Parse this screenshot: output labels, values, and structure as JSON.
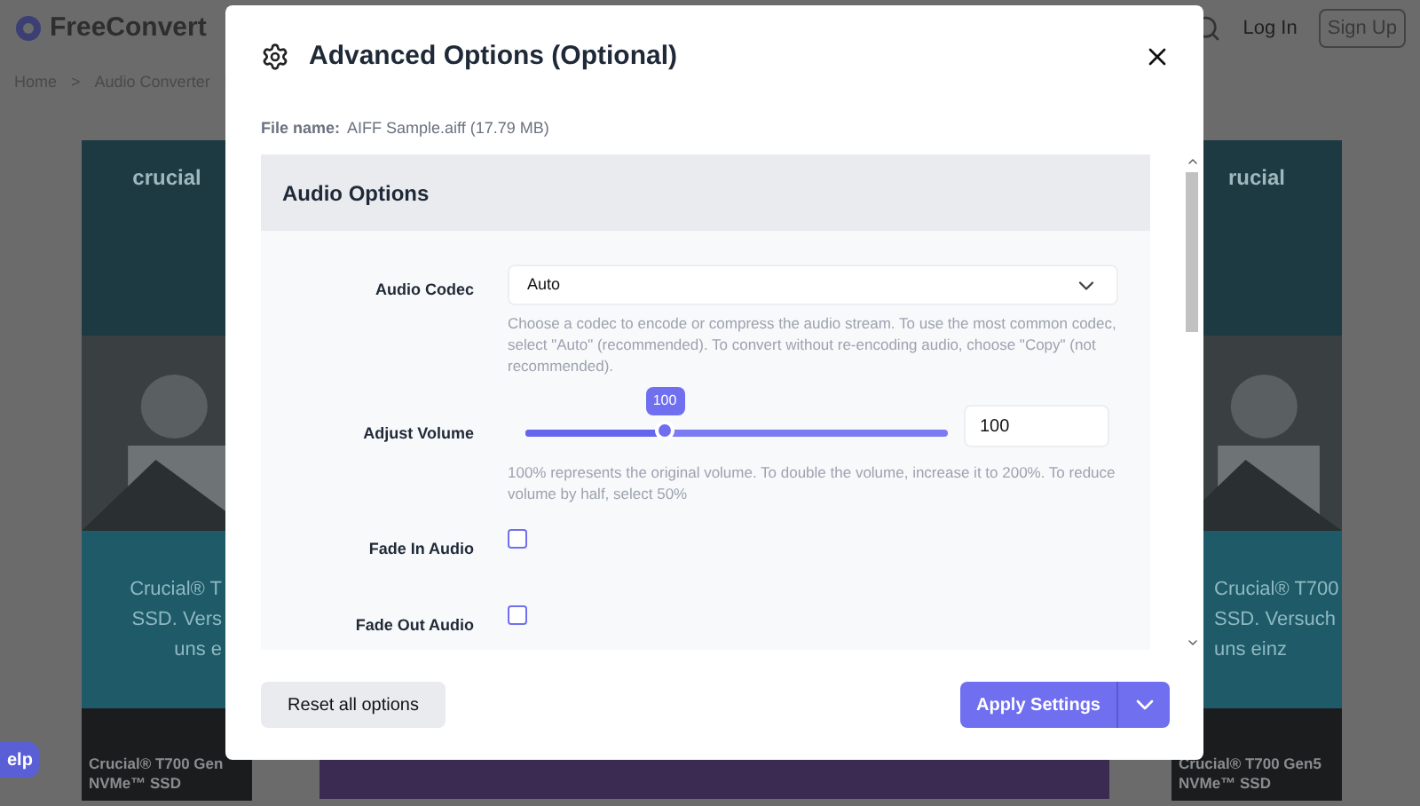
{
  "site_header": {
    "logo": "FreeConvert",
    "breadcrumbs": [
      "Home",
      "Audio Converter"
    ],
    "separator": ">",
    "login": "Log In",
    "signup": "Sign Up"
  },
  "ads": [
    {
      "brand": "crucial",
      "lines": [
        "Crucial® T",
        "SSD. Vers",
        "uns e"
      ],
      "caption": [
        "Crucial® T700 Gen",
        "NVMe™ SSD"
      ]
    },
    {
      "brand": "rucial",
      "lines": [
        "Crucial® T700",
        "SSD. Versuch",
        "uns einz"
      ],
      "caption": [
        "Crucial® T700 Gen5",
        "NVMe™ SSD"
      ]
    }
  ],
  "help_button": "elp",
  "dialog": {
    "title": "Advanced Options (Optional)",
    "file_label": "File name:",
    "file_value": "AIFF Sample.aiff (17.79 MB)",
    "section_title": "Audio Options",
    "rows": [
      {
        "kind": "select",
        "label": "Audio Codec",
        "value": "Auto",
        "help": "Choose a codec to encode or compress the audio stream. To use the most common codec, select \"Auto\" (recommended). To convert without re-encoding audio, choose \"Copy\" (not recommended)."
      },
      {
        "kind": "slider",
        "label": "Adjust Volume",
        "bubble": "100",
        "level": 0.33,
        "value": "100",
        "help": "100% represents the original volume. To double the volume, increase it to 200%. To reduce volume by half, select 50%"
      },
      {
        "kind": "checkbox",
        "label": "Fade In Audio",
        "checked": false
      },
      {
        "kind": "checkbox",
        "label": "Fade Out Audio",
        "checked": false
      }
    ],
    "reset_button": "Reset all options",
    "apply_button": "Apply Settings"
  }
}
